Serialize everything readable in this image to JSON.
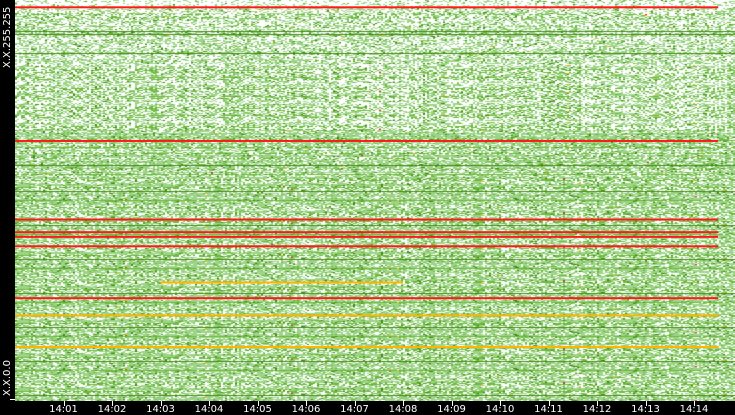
{
  "chart_data": {
    "type": "heatmap",
    "title": "",
    "xlabel": "",
    "ylabel": "",
    "x_ticks": [
      "14:01",
      "14:02",
      "14:03",
      "14:04",
      "14:05",
      "14:06",
      "14:07",
      "14:08",
      "14:09",
      "14:10",
      "14:11",
      "14:12",
      "14:13",
      "14:14"
    ],
    "x_range": [
      "14:00",
      "14:14:30"
    ],
    "y_top_label": "X.X.255.255",
    "y_bottom_label": "X.X.0.0",
    "y_range": [
      0,
      255
    ],
    "highlighted_rows": [
      {
        "row": 251,
        "color": "red",
        "start": "14:00",
        "end": "14:14:30"
      },
      {
        "row": 166,
        "color": "red",
        "start": "14:00",
        "end": "14:14:30"
      },
      {
        "row": 116,
        "color": "red",
        "start": "14:00",
        "end": "14:14:30"
      },
      {
        "row": 108,
        "color": "red",
        "start": "14:00",
        "end": "14:14:30"
      },
      {
        "row": 105,
        "color": "red",
        "start": "14:00",
        "end": "14:14:30"
      },
      {
        "row": 99,
        "color": "red",
        "start": "14:00",
        "end": "14:14:30"
      },
      {
        "row": 66,
        "color": "red",
        "start": "14:00",
        "end": "14:14:30"
      },
      {
        "row": 76,
        "color": "orange",
        "start": "14:03",
        "end": "14:08"
      },
      {
        "row": 55,
        "color": "orange",
        "start": "14:00",
        "end": "14:14:30"
      },
      {
        "row": 35,
        "color": "orange",
        "start": "14:00",
        "end": "14:14:30"
      }
    ],
    "colors": {
      "low": "#9ed48a",
      "mid": "#6cb83a",
      "high": "#3f8a10",
      "warn": "#ffb400",
      "alert": "#ff1a1a",
      "empty": "#ffffff"
    }
  }
}
